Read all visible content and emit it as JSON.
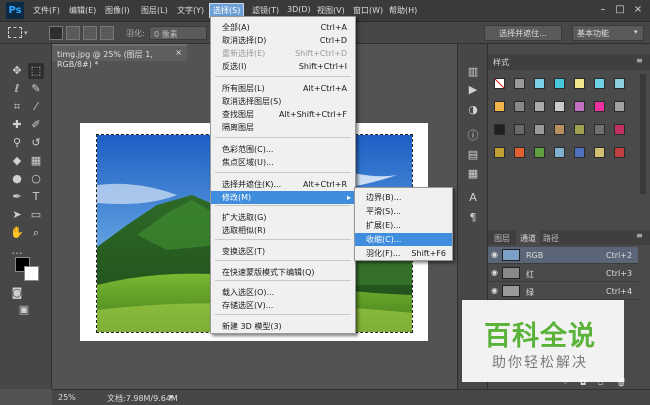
{
  "menubar": {
    "logo": "Ps",
    "items": [
      "文件(F)",
      "编辑(E)",
      "图像(I)",
      "图层(L)",
      "文字(Y)",
      "选择(S)",
      "滤镜(T)",
      "3D(D)",
      "视图(V)",
      "窗口(W)",
      "帮助(H)"
    ],
    "active": "选择(S)"
  },
  "options": {
    "feather_label": "羽化:",
    "feather_value": "0 像素",
    "select_mask_button": "选择并遮住...",
    "workspace": "基本功能"
  },
  "document": {
    "tab_title": "timg.jpg @ 25% (图层 1, RGB/8#) *",
    "tab_close": "×"
  },
  "statusbar": {
    "zoom": "25%",
    "doc_info": "文档:7.98M/9.64M"
  },
  "select_menu": {
    "items": [
      {
        "label": "全部(A)",
        "shortcut": "Ctrl+A"
      },
      {
        "label": "取消选择(D)",
        "shortcut": "Ctrl+D"
      },
      {
        "label": "重新选择(E)",
        "shortcut": "Shift+Ctrl+D",
        "disabled": true
      },
      {
        "label": "反选(I)",
        "shortcut": "Shift+Ctrl+I"
      },
      {
        "label": "所有图层(L)",
        "shortcut": "Alt+Ctrl+A"
      },
      {
        "label": "取消选择图层(S)",
        "shortcut": ""
      },
      {
        "label": "查找图层",
        "shortcut": "Alt+Shift+Ctrl+F"
      },
      {
        "label": "隔离图层",
        "shortcut": ""
      },
      {
        "label": "色彩范围(C)...",
        "shortcut": ""
      },
      {
        "label": "焦点区域(U)...",
        "shortcut": ""
      },
      {
        "label": "选择并遮住(K)...",
        "shortcut": "Alt+Ctrl+R"
      },
      {
        "label": "修改(M)",
        "shortcut": "",
        "submenu": true,
        "highlighted": true
      },
      {
        "label": "扩大选取(G)",
        "shortcut": ""
      },
      {
        "label": "选取相似(R)",
        "shortcut": ""
      },
      {
        "label": "变换选区(T)",
        "shortcut": ""
      },
      {
        "label": "在快速蒙版模式下编辑(Q)",
        "shortcut": ""
      },
      {
        "label": "载入选区(O)...",
        "shortcut": ""
      },
      {
        "label": "存储选区(V)...",
        "shortcut": ""
      },
      {
        "label": "新建 3D 模型(3)",
        "shortcut": ""
      }
    ]
  },
  "modify_submenu": {
    "items": [
      {
        "label": "边界(B)...",
        "shortcut": ""
      },
      {
        "label": "平滑(S)...",
        "shortcut": ""
      },
      {
        "label": "扩展(E)...",
        "shortcut": ""
      },
      {
        "label": "收缩(C)...",
        "shortcut": "",
        "highlighted": true
      },
      {
        "label": "羽化(F)...",
        "shortcut": "Shift+F6"
      }
    ]
  },
  "styles_panel": {
    "title": "样式"
  },
  "channels_panel": {
    "tabs": [
      "图层",
      "通道",
      "路径"
    ],
    "active_tab": "通道",
    "rows": [
      {
        "name": "RGB",
        "shortcut": "Ctrl+2"
      },
      {
        "name": "红",
        "shortcut": "Ctrl+3"
      },
      {
        "name": "绿",
        "shortcut": "Ctrl+4"
      }
    ]
  },
  "watermark": {
    "title": "百科全说",
    "subtitle": "助你轻松解决"
  },
  "colors": {
    "menu_highlight": "#3f8ddc",
    "ps_blue": "#31a8ff",
    "watermark_green": "#5bb33a"
  }
}
